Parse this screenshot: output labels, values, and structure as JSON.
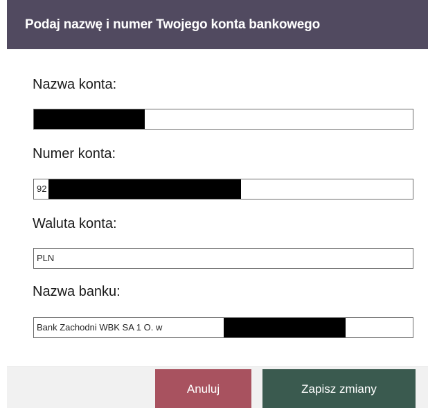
{
  "dialog": {
    "title": "Podaj nazwę i numer Twojego konta bankowego"
  },
  "fields": {
    "account_name": {
      "label": "Nazwa konta:",
      "value": ""
    },
    "account_number": {
      "label": "Numer konta:",
      "value": "92"
    },
    "account_currency": {
      "label": "Waluta konta:",
      "value": "PLN"
    },
    "bank_name": {
      "label": "Nazwa banku:",
      "value": "Bank Zachodni WBK SA 1 O. w"
    }
  },
  "buttons": {
    "cancel_label": "Anuluj",
    "save_label": "Zapisz zmiany"
  },
  "colors": {
    "header_bg": "#514a60",
    "cancel_bg": "#a8525f",
    "save_bg": "#3a5a4f",
    "footer_bg": "#f1f1f1",
    "redaction": "#000000"
  }
}
